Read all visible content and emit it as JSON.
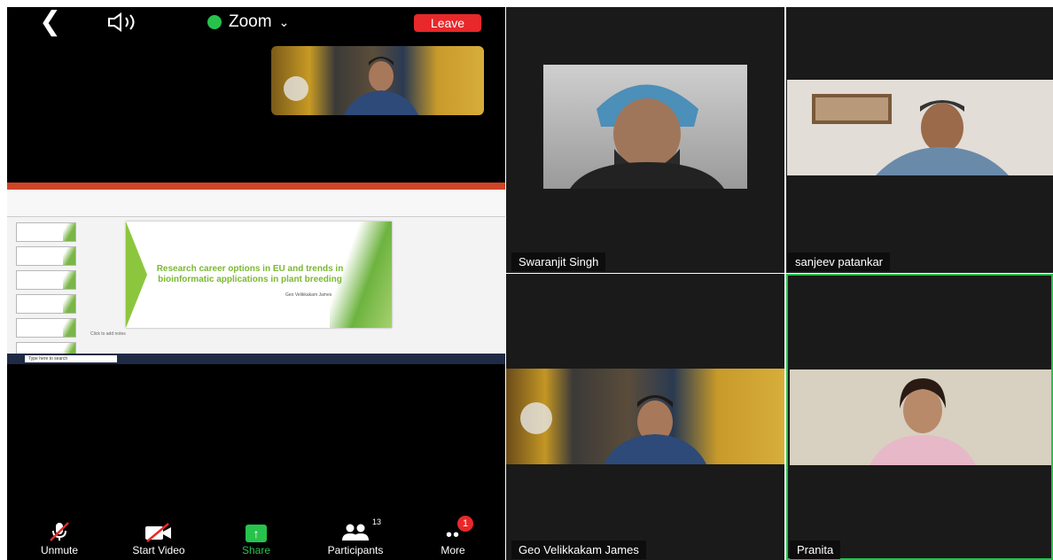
{
  "app": {
    "title": "Zoom",
    "leave_label": "Leave"
  },
  "shared_slide": {
    "title": "Research career options in EU and trends in bioinformatic applications in plant breeding",
    "presenter": "Geo Velikkakam James",
    "notes_placeholder": "Click to add notes",
    "taskbar_search": "Type here to search"
  },
  "toolbar": {
    "unmute": "Unmute",
    "start_video": "Start Video",
    "share": "Share",
    "participants": "Participants",
    "participants_count": "13",
    "more": "More",
    "more_badge": "1"
  },
  "participants": [
    {
      "name": "Swaranjit Singh"
    },
    {
      "name": "sanjeev patankar"
    },
    {
      "name": "Geo Velikkakam James"
    },
    {
      "name": "Pranita"
    }
  ],
  "colors": {
    "accent_green": "#27c24c",
    "leave_red": "#e8282b"
  }
}
